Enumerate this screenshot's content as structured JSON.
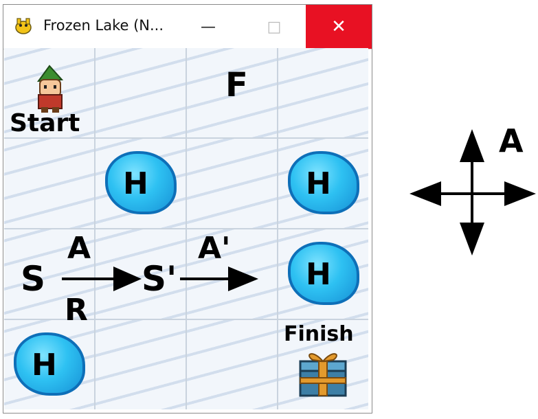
{
  "window": {
    "title": "Frozen Lake (N...",
    "minimize_glyph": "—",
    "maximize_glyph": "□",
    "close_glyph": "✕",
    "close_color": "#e81123"
  },
  "grid": {
    "rows": 4,
    "cols": 4,
    "hole_label": "H",
    "frozen_label": "F",
    "start_label": "Start",
    "finish_label": "Finish",
    "hole_color": "#2ec1f2",
    "ice_color": "#f2f6fb"
  },
  "annotations": {
    "state": "S",
    "action": "A",
    "reward": "R",
    "next_state": "S'",
    "next_action": "A'"
  },
  "legend": {
    "action_label": "A",
    "icon": "four-way-arrows-icon"
  }
}
